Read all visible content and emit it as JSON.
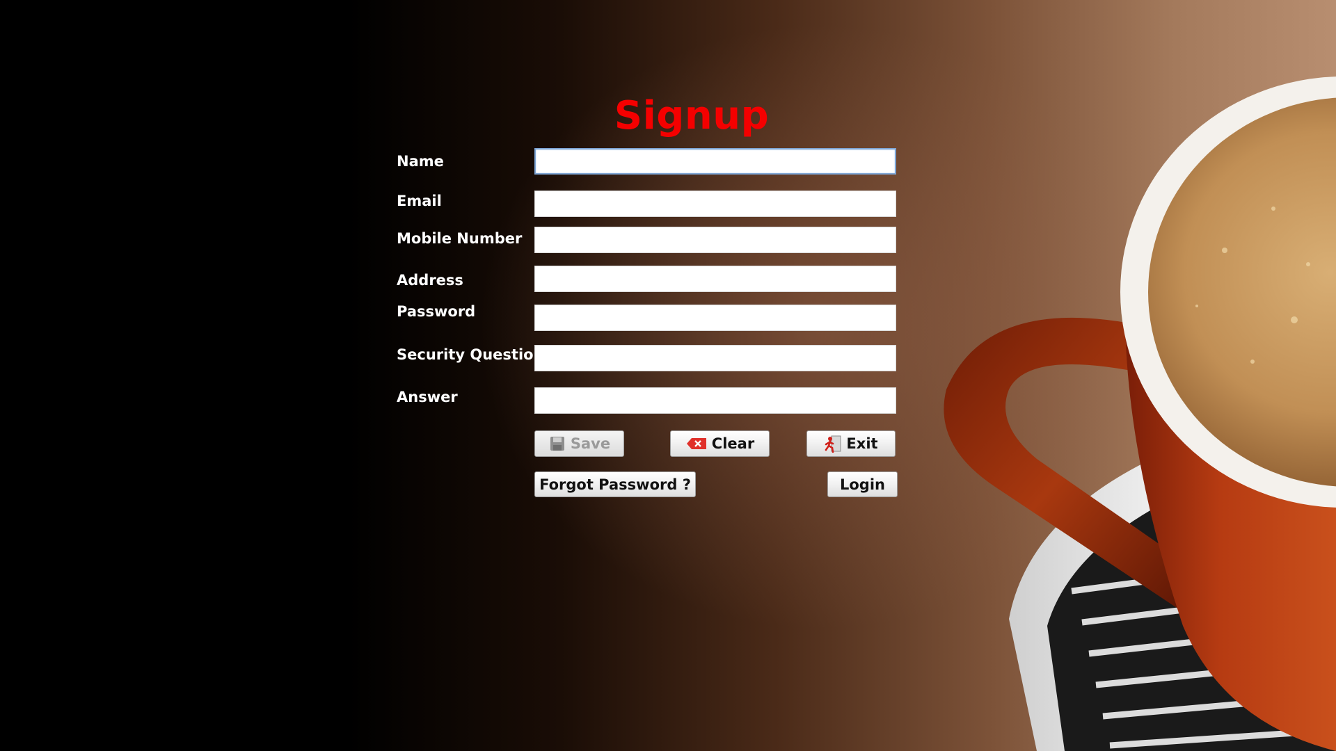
{
  "title": "Signup",
  "fields": [
    {
      "label": "Name",
      "value": ""
    },
    {
      "label": "Email",
      "value": ""
    },
    {
      "label": "Mobile Number",
      "value": ""
    },
    {
      "label": "Address",
      "value": ""
    },
    {
      "label": "Password",
      "value": ""
    },
    {
      "label": "Security Question",
      "value": ""
    },
    {
      "label": "Answer",
      "value": ""
    }
  ],
  "buttons": {
    "save": "Save",
    "clear": "Clear",
    "exit": "Exit",
    "forgot": "Forgot Password ?",
    "login": "Login"
  },
  "icons": {
    "save": "floppy-disk-icon",
    "clear": "clear-eraser-icon",
    "exit": "exit-door-icon"
  },
  "colors": {
    "title": "#f50000",
    "label": "#ffffff",
    "focus_border": "#7ea6d6"
  },
  "state": {
    "focused_field": "Name",
    "save_enabled": false
  }
}
